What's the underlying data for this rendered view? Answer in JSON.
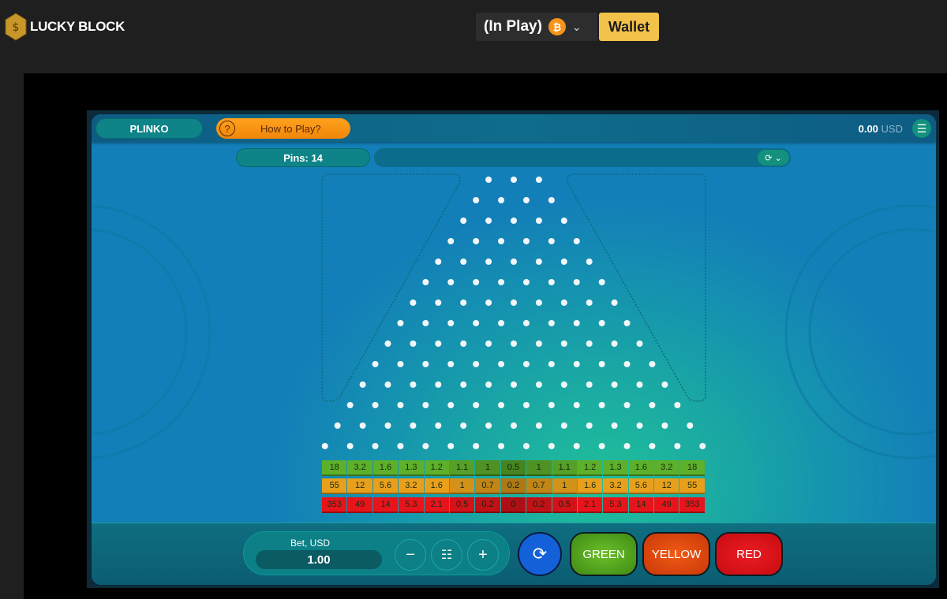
{
  "site": {
    "brand": "LUCKY BLOCK",
    "in_play": "(In Play)",
    "currency_icon": "bitcoin-icon",
    "currency_symbol": "₿",
    "wallet_label": "Wallet"
  },
  "game": {
    "title": "PLINKO",
    "how_to_play": "How to Play?",
    "balance_value": "0.00",
    "balance_currency": "USD",
    "pins_label": "Pins: 14",
    "pin_rows": 14
  },
  "multipliers": {
    "green": [
      "18",
      "3.2",
      "1.6",
      "1.3",
      "1.2",
      "1.1",
      "1",
      "0.5",
      "1",
      "1.1",
      "1.2",
      "1.3",
      "1.6",
      "3.2",
      "18"
    ],
    "yellow": [
      "55",
      "12",
      "5.6",
      "3.2",
      "1.6",
      "1",
      "0.7",
      "0.2",
      "0.7",
      "1",
      "1.6",
      "3.2",
      "5.6",
      "12",
      "55"
    ],
    "red": [
      "353",
      "49",
      "14",
      "5.3",
      "2.1",
      "0.5",
      "0.2",
      "0",
      "0.2",
      "0.5",
      "2.1",
      "5.3",
      "14",
      "49",
      "353"
    ]
  },
  "colors": {
    "green": "#5db02a",
    "yellow": "#e8a01c",
    "red": "#e8141c",
    "wallet": "#f3c24a",
    "auto": "#1360d8"
  },
  "controls": {
    "bet_label": "Bet, USD",
    "bet_value": "1.00",
    "minus": "−",
    "plus": "+",
    "green": "GREEN",
    "yellow": "YELLOW",
    "red": "RED"
  }
}
